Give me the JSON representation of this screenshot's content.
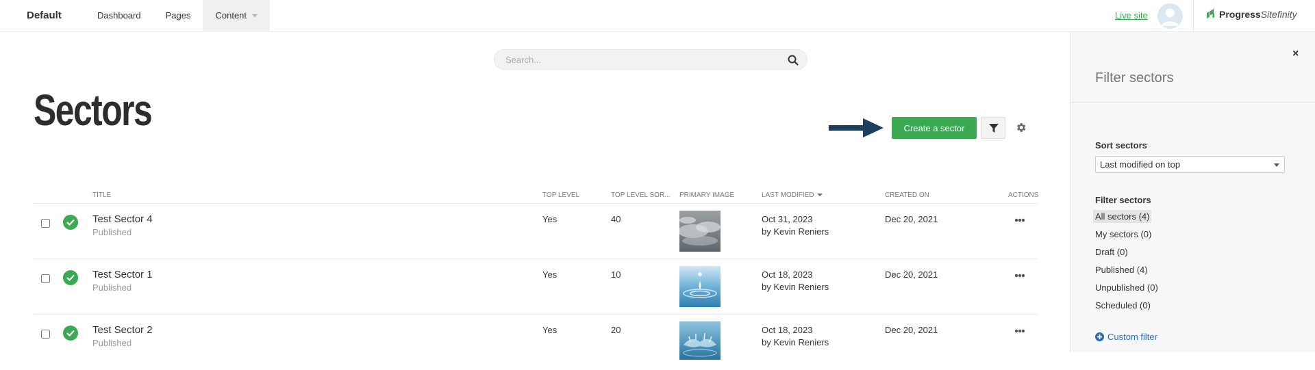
{
  "topbar": {
    "brand": "Default",
    "nav": [
      {
        "label": "Dashboard"
      },
      {
        "label": "Pages"
      },
      {
        "label": "Content"
      }
    ],
    "live_site": "Live site",
    "logo_primary": "Progress",
    "logo_secondary": "Sitefinity"
  },
  "search": {
    "placeholder": "Search..."
  },
  "page": {
    "title": "Sectors"
  },
  "toolbar": {
    "create_label": "Create a sector"
  },
  "colors": {
    "accent": "#3aa952",
    "link": "#2f6db3",
    "arrow": "#1d3f5e"
  },
  "table": {
    "columns": {
      "title": "TITLE",
      "top_level": "TOP LEVEL",
      "sort": "TOP LEVEL SOR...",
      "image": "PRIMARY IMAGE",
      "modified": "LAST MODIFIED",
      "created": "CREATED ON",
      "actions": "ACTIONS"
    },
    "rows": [
      {
        "title": "Test Sector 4",
        "status": "Published",
        "top_level": "Yes",
        "sort": "40",
        "modified_date": "Oct 31, 2023",
        "modified_by": "by Kevin Reniers",
        "created": "Dec 20, 2021",
        "image": "clouds"
      },
      {
        "title": "Test Sector 1",
        "status": "Published",
        "top_level": "Yes",
        "sort": "10",
        "modified_date": "Oct 18, 2023",
        "modified_by": "by Kevin Reniers",
        "created": "Dec 20, 2021",
        "image": "water-drop"
      },
      {
        "title": "Test Sector 2",
        "status": "Published",
        "top_level": "Yes",
        "sort": "20",
        "modified_date": "Oct 18, 2023",
        "modified_by": "by Kevin Reniers",
        "created": "Dec 20, 2021",
        "image": "water-splash"
      }
    ]
  },
  "panel": {
    "title": "Filter sectors",
    "sort_label": "Sort sectors",
    "sort_value": "Last modified on top",
    "filter_label": "Filter sectors",
    "filters": [
      {
        "label": "All sectors (4)"
      },
      {
        "label": "My sectors (0)"
      },
      {
        "label": "Draft (0)"
      },
      {
        "label": "Published (4)"
      },
      {
        "label": "Unpublished (0)"
      },
      {
        "label": "Scheduled (0)"
      }
    ],
    "custom_filter": "Custom filter",
    "close_glyph": "×"
  }
}
